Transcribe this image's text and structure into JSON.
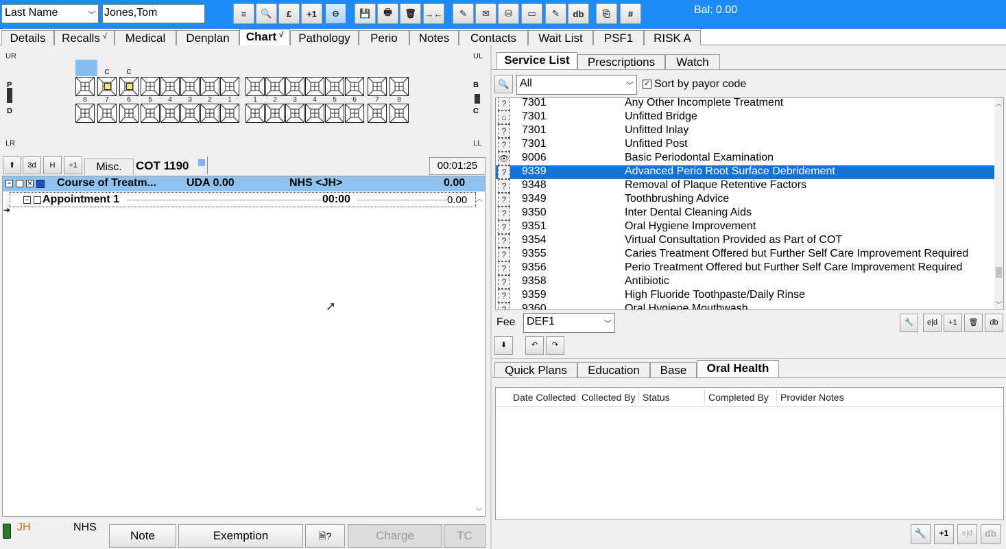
{
  "topbar": {
    "search_field_value": "Last Name",
    "patient_name_value": "Jones,Tom",
    "balance": "Bal: 0.00",
    "buttons": [
      "≡",
      "🔍",
      "£",
      "+1",
      "⊖",
      "💾",
      "🖶",
      "🗑",
      "→←",
      "✎",
      "✉",
      "⛁",
      "▭",
      "✎",
      "db",
      "⎘",
      "#"
    ]
  },
  "tabs": [
    "Details",
    "Recalls",
    "Medical",
    "Denplan",
    "Chart",
    "Pathology",
    "Perio",
    "Notes",
    "Contacts",
    "Wait List",
    "PSF1",
    "RISK A"
  ],
  "tab_ticks": {
    "recalls": "√",
    "chart": "√"
  },
  "chart": {
    "quadrants": {
      "ur": "UR",
      "ul": "UL",
      "lr": "LR",
      "ll": "LL"
    },
    "left_letters": [
      "P",
      "D"
    ],
    "right_letters": [
      "B",
      "C"
    ],
    "upper_labels": [
      "C",
      "C"
    ],
    "tooth_numbers_right": [
      "8",
      "7",
      "6",
      "5",
      "4",
      "3",
      "2",
      "1"
    ],
    "tooth_numbers_left": [
      "1",
      "2",
      "3",
      "4",
      "5",
      "6",
      "7",
      "8"
    ]
  },
  "course": {
    "buttons": [
      "⬆",
      "3d",
      "H",
      "+1"
    ],
    "misc_tab": "Misc.",
    "cot_label": "COT 1190",
    "timer": "00:01:25",
    "header_title": "Course of Treatm...",
    "header_uda": "UDA 0.00",
    "header_nhs": "NHS <JH>",
    "header_amount": "0.00",
    "appointment_label": "Appointment 1",
    "appointment_time": "00:00",
    "appointment_amount": "0.00"
  },
  "bottom": {
    "provider": "JH",
    "scheme": "NHS",
    "note": "Note",
    "exemption": "Exemption",
    "doc": "🗎?",
    "charge": "Charge",
    "tc": "TC"
  },
  "right": {
    "tabs": [
      "Service List",
      "Prescriptions",
      "Watch"
    ],
    "filter_value": "All",
    "sort_label": "Sort by payor code",
    "fee_label": "Fee",
    "fee_value": "DEF1",
    "lower_tabs": [
      "Quick Plans",
      "Education",
      "Base",
      "Oral Health"
    ],
    "oral_health_columns": [
      "Date Collected",
      "Collected By",
      "Status",
      "Completed By",
      "Provider Notes"
    ]
  },
  "services": [
    {
      "code": "7301",
      "desc": "Any Other Incomplete Treatment",
      "icon": "?"
    },
    {
      "code": "7301",
      "desc": "Unfitted Bridge",
      "icon": "⌂"
    },
    {
      "code": "7301",
      "desc": "Unfitted Inlay",
      "icon": "?"
    },
    {
      "code": "7301",
      "desc": "Unfitted Post",
      "icon": "?"
    },
    {
      "code": "9006",
      "desc": "Basic Periodontal Examination",
      "icon": "👁"
    },
    {
      "code": "9339",
      "desc": "Advanced Perio Root Surface Debridement",
      "icon": "?",
      "selected": true
    },
    {
      "code": "9348",
      "desc": "Removal of Plaque Retentive Factors",
      "icon": "?"
    },
    {
      "code": "9349",
      "desc": "Toothbrushing Advice",
      "icon": "?"
    },
    {
      "code": "9350",
      "desc": "Inter Dental Cleaning Aids",
      "icon": "?"
    },
    {
      "code": "9351",
      "desc": "Oral Hygiene Improvement",
      "icon": "?"
    },
    {
      "code": "9354",
      "desc": "Virtual Consultation Provided as Part of COT",
      "icon": "?"
    },
    {
      "code": "9355",
      "desc": "Caries Treatment Offered but Further  Self Care Improvement Required",
      "icon": "?"
    },
    {
      "code": "9356",
      "desc": "Perio Treatment Offered but Further Self Care Improvement Required",
      "icon": "?"
    },
    {
      "code": "9358",
      "desc": "Antibiotic",
      "icon": "?"
    },
    {
      "code": "9359",
      "desc": "High Fluoride Toothpaste/Daily Rinse",
      "icon": "?"
    },
    {
      "code": "9360",
      "desc": "Oral Hygiene Mouthwash",
      "icon": "?"
    }
  ],
  "colors": {
    "topbar": "#1d8cf8",
    "selected_row": "#1673d6",
    "course_header": "#8fc2ef"
  }
}
